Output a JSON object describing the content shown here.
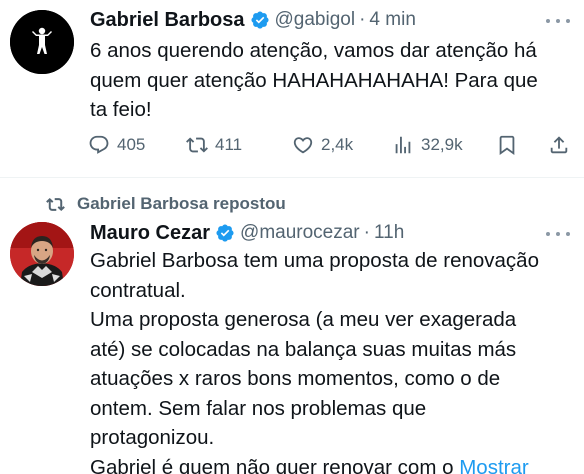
{
  "tweet1": {
    "author_name": "Gabriel Barbosa",
    "handle": "@gabigol",
    "separator": "·",
    "time": "4 min",
    "text_lines": [
      "6 anos querendo atenção, vamos dar atenção há",
      "quem quer atenção HAHAHAHAHAHA! Para que",
      "ta feio!"
    ],
    "avatar_icon": "athlete-silhouette-icon",
    "actions": {
      "replies": "405",
      "reposts": "411",
      "likes": "2,4k",
      "views": "32,9k"
    }
  },
  "repost_header": {
    "label": "Gabriel Barbosa repostou"
  },
  "tweet2": {
    "author_name": "Mauro Cezar",
    "handle": "@maurocezar",
    "separator": "·",
    "time": "11h",
    "text_lines": [
      "Gabriel Barbosa tem uma proposta de renovação",
      "contratual.",
      "Uma proposta generosa (a meu ver exagerada",
      "até) se colocadas na balança suas muitas más",
      "atuações x raros bons momentos, como o de",
      "ontem. Sem falar nos problemas que",
      "protagonizou.",
      "Gabriel é quem não quer renovar com o"
    ],
    "show_more": "Mostrar"
  },
  "colors": {
    "text": "#0f1419",
    "secondary": "#536471",
    "link": "#1d9bf0",
    "verified": "#1d9bf0"
  }
}
